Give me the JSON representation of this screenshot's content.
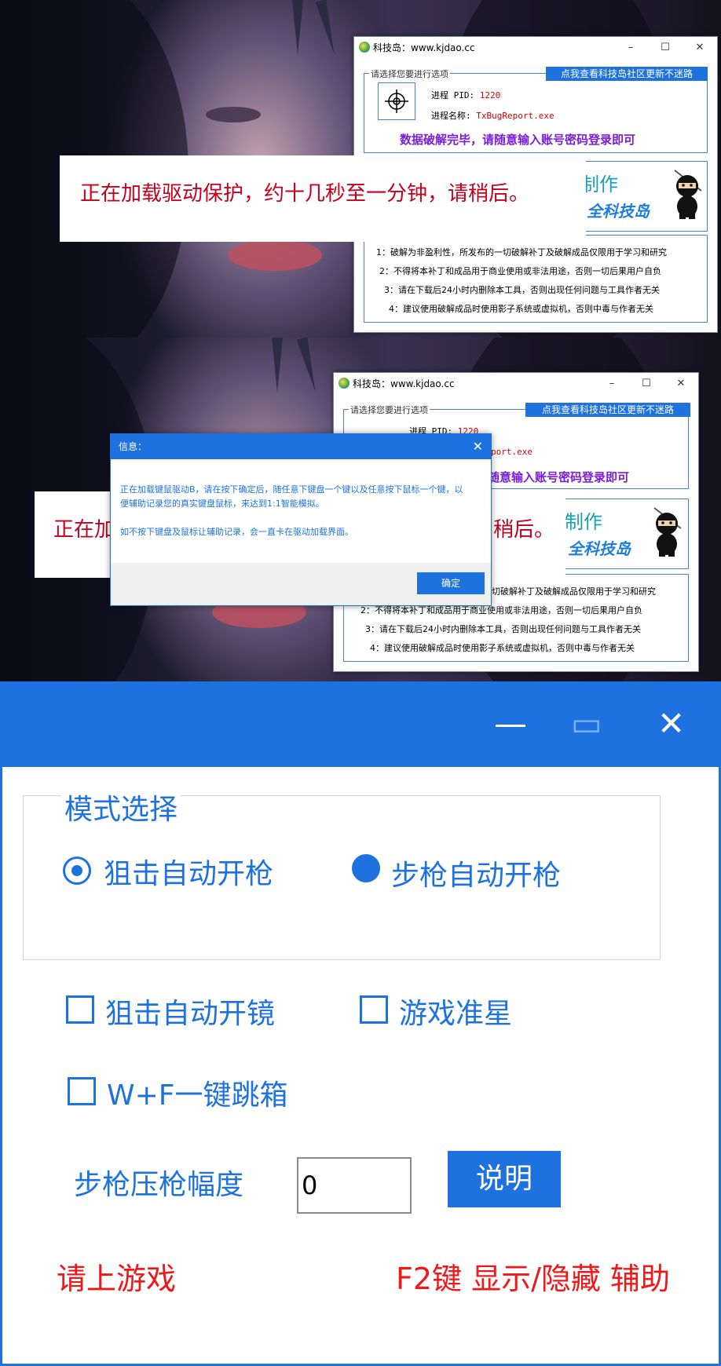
{
  "window": {
    "title": "科技岛：www.kjdao.cc",
    "minimize": "–",
    "maximize": "☐",
    "close": "✕"
  },
  "panel": {
    "group_label": "请选择您要进行选项",
    "community_button": "点我查看科技岛社区更新不迷路",
    "pid_label": "进程 PID:",
    "pid_value": "1220",
    "name_label": "进程名称:",
    "name_value": "TxBugReport.exe",
    "name_value_partial": "port.exe",
    "status_message": "数据破解完毕，请随意输入账号密码登录即可",
    "status_message_partial": "随意输入账号密码登录即可",
    "made_text": "制作",
    "brand_text": "全科技岛",
    "rules": [
      "1：破解为非盈利性，所发布的一切破解补丁及破解成品仅限用于学习和研究",
      "2：不得将本补丁和成品用于商业使用或非法用途，否则一切后果用户自负",
      "3：请在下载后24小时内删除本工具，否则出现任何问题与工具作者无关",
      "4：建议使用破解成品时使用影子系统或虚拟机，否则中毒与作者无关"
    ],
    "rule1_partial": "一切破解补丁及破解成品仅限用于学习和研究",
    "rule2_partial": "2：不得将本补丁和成品用于商业使用或非法用途，否则一切后果用户自负"
  },
  "loading_banner": {
    "full": "正在加载驱动保护，约十几秒至一分钟，请稍后。",
    "left_part": "正在加",
    "right_part": "稍后。"
  },
  "dialog": {
    "title": "信息：",
    "close": "✕",
    "line1": "正在加载键鼠驱动B，请在按下确定后，随任意下键盘一个键以及任意按下鼠标一个键，以便辅助记录您的真实键盘鼠标，来达到1:1智能模拟。",
    "line2": "如不按下键盘及鼠标让辅助记录，会一直卡在驱动加载界面。",
    "ok": "确定"
  },
  "assist": {
    "minimize": "—",
    "maximize": "▭",
    "close": "✕",
    "mode_label": "模式选择",
    "mode_options": [
      "狙击自动开枪",
      "步枪自动开枪"
    ],
    "checkboxes": [
      "狙击自动开镜",
      "游戏准星",
      "W+F一键跳箱"
    ],
    "recoil_label": "步枪压枪幅度",
    "recoil_value": "0",
    "help_button": "说明",
    "status_left": "请上游戏",
    "status_right": "F2键 显示/隐藏 辅助"
  },
  "colors": {
    "accent": "#1d72df",
    "status_red": "#f01818",
    "banner_red": "#c4001c",
    "purple": "#7a1ed8"
  }
}
